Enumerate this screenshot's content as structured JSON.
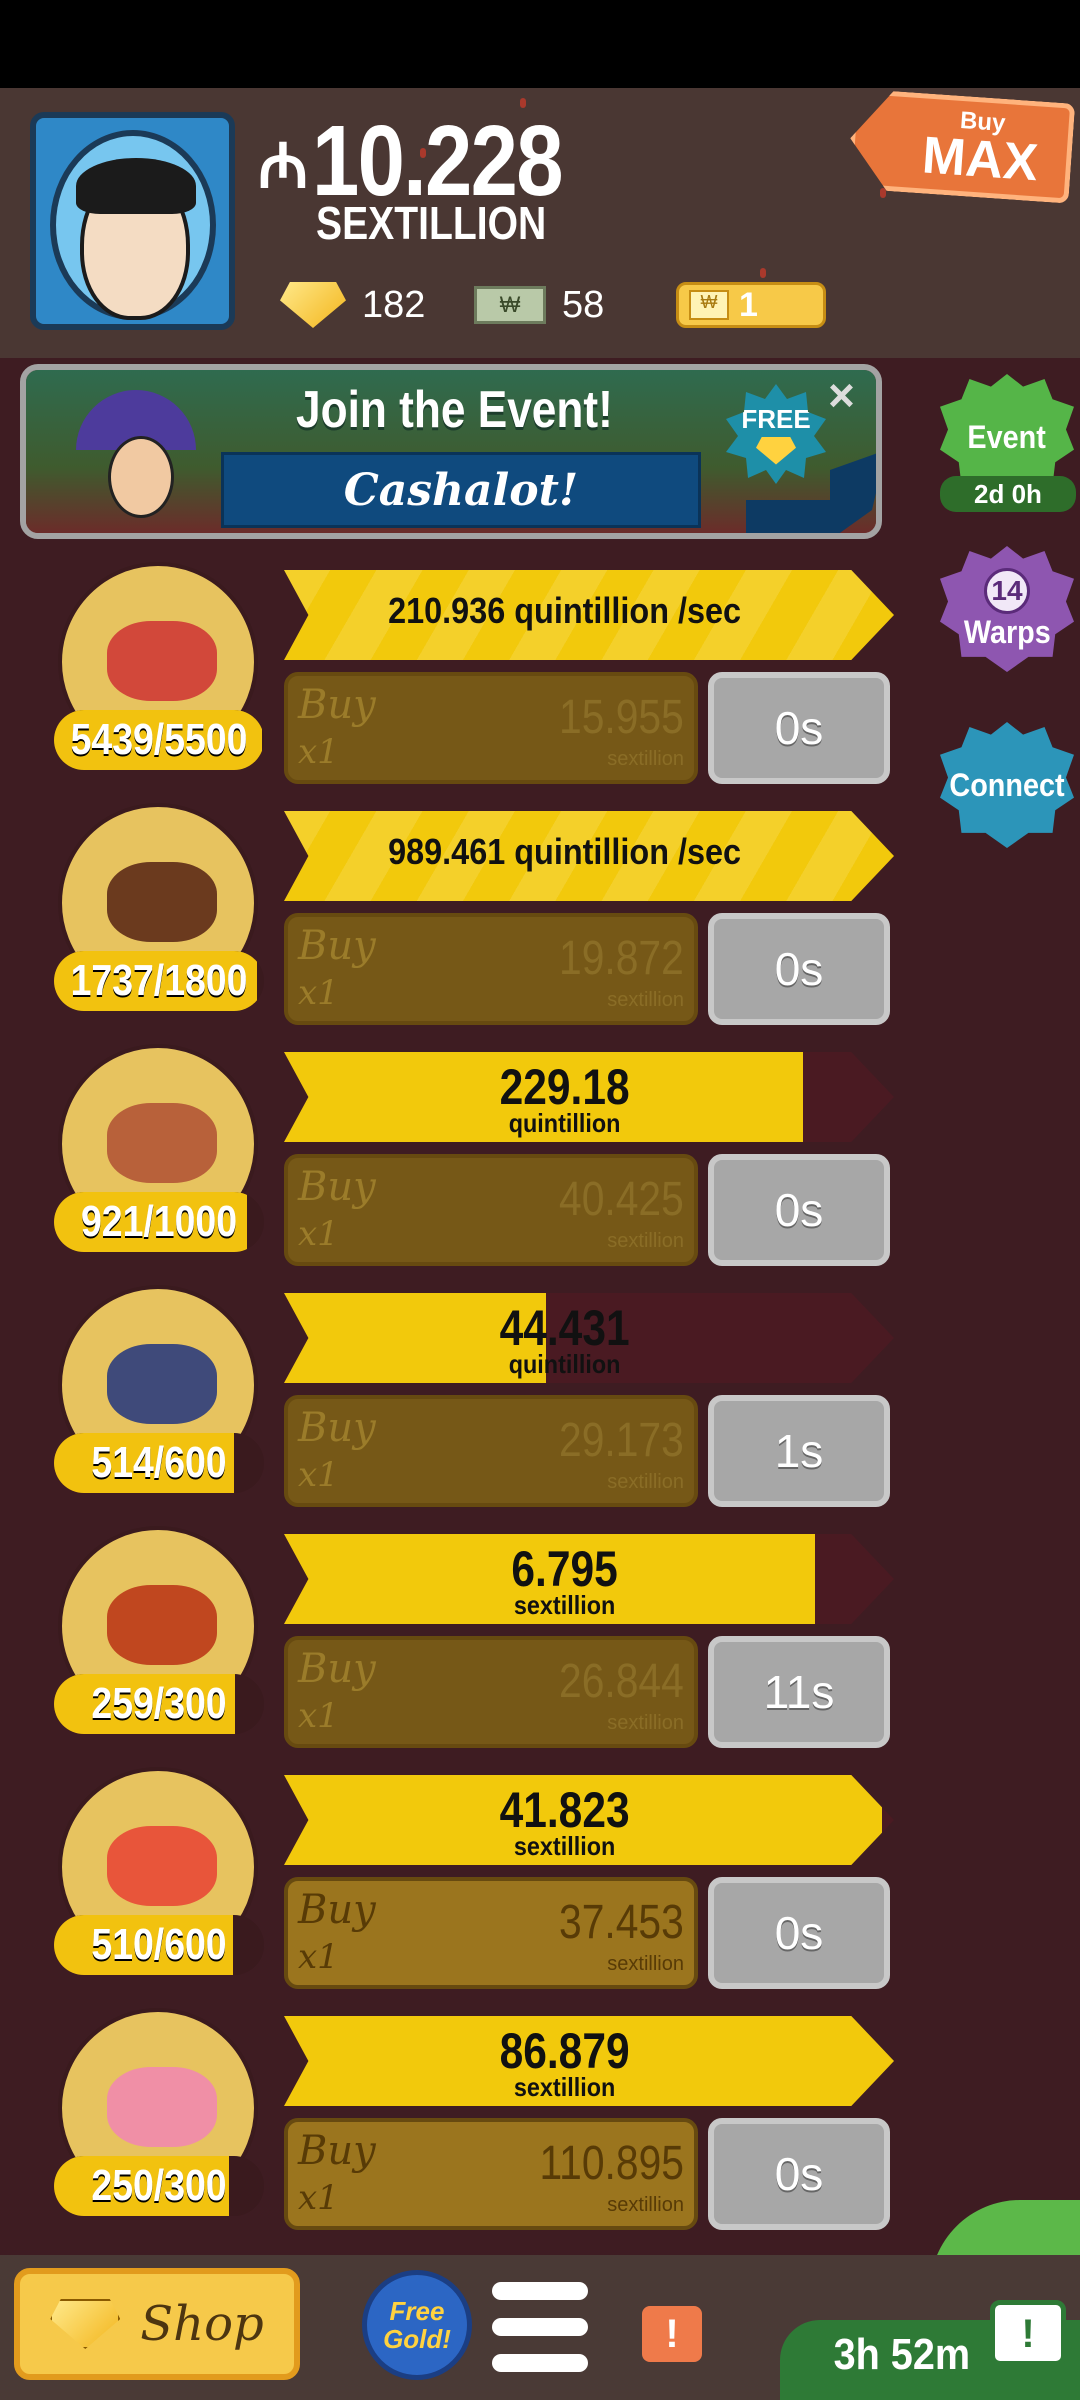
{
  "header": {
    "currency_symbol": "₼",
    "money_value": "10.228",
    "money_unit": "SEXTILLION",
    "gold": "182",
    "megabucks_icon_text": "₩",
    "megabucks": "58",
    "tickets": "1",
    "ticket_icon_text": "₩",
    "buy_max_small": "Buy",
    "buy_max_big": "MAX"
  },
  "event_banner": {
    "title": "Join the Event!",
    "event_name": "Cashalot!",
    "free_label": "FREE",
    "close": "×"
  },
  "side_buttons": {
    "event_label": "Event",
    "event_time": "2d 0h",
    "warps_count": "14",
    "warps_label": "Warps",
    "connect_label": "Connect"
  },
  "businesses": [
    {
      "icon": "red-dirt-icon",
      "progress_text": "5439/5500",
      "progress": 0.989,
      "revenue_mode": "rate",
      "revenue_text": "210.936 quintillion /sec",
      "revenue_fill": 1.0,
      "buy_line1": "Buy",
      "buy_line2": "x1",
      "cost": "15.955",
      "cost_unit": "sextillion",
      "timer": "0s",
      "affordable": false
    },
    {
      "icon": "chocolate-bar-icon",
      "progress_text": "1737/1800",
      "progress": 0.965,
      "revenue_mode": "rate",
      "revenue_text": "989.461 quintillion /sec",
      "revenue_fill": 1.0,
      "buy_line1": "Buy",
      "buy_line2": "x1",
      "cost": "19.872",
      "cost_unit": "sextillion",
      "timer": "0s",
      "affordable": false
    },
    {
      "icon": "bearded-man-icon",
      "progress_text": "921/1000",
      "progress": 0.921,
      "revenue_mode": "value",
      "revenue_value": "229.18",
      "revenue_unit": "quintillion",
      "revenue_fill": 0.85,
      "buy_line1": "Buy",
      "buy_line2": "x1",
      "cost": "40.425",
      "cost_unit": "sextillion",
      "timer": "0s",
      "affordable": false
    },
    {
      "icon": "spotted-bug-icon",
      "progress_text": "514/600",
      "progress": 0.857,
      "revenue_mode": "value",
      "revenue_value": "44.431",
      "revenue_unit": "quintillion",
      "revenue_fill": 0.43,
      "buy_line1": "Buy",
      "buy_line2": "x1",
      "cost": "29.173",
      "cost_unit": "sextillion",
      "timer": "1s",
      "affordable": false
    },
    {
      "icon": "dollar-coin-icon",
      "progress_text": "259/300",
      "progress": 0.863,
      "revenue_mode": "value",
      "revenue_value": "6.795",
      "revenue_unit": "sextillion",
      "revenue_fill": 0.87,
      "buy_line1": "Buy",
      "buy_line2": "x1",
      "cost": "26.844",
      "cost_unit": "sextillion",
      "timer": "11s",
      "affordable": false
    },
    {
      "icon": "space-clam-icon",
      "progress_text": "510/600",
      "progress": 0.85,
      "revenue_mode": "value",
      "revenue_value": "41.823",
      "revenue_unit": "sextillion",
      "revenue_fill": 0.98,
      "buy_line1": "Buy",
      "buy_line2": "x1",
      "cost": "37.453",
      "cost_unit": "sextillion",
      "timer": "0s",
      "affordable": true
    },
    {
      "icon": "brain-sunglasses-icon",
      "progress_text": "250/300",
      "progress": 0.833,
      "revenue_mode": "value",
      "revenue_value": "86.879",
      "revenue_unit": "sextillion",
      "revenue_fill": 1.0,
      "buy_line1": "Buy",
      "buy_line2": "x1",
      "cost": "110.895",
      "cost_unit": "sextillion",
      "timer": "0s",
      "affordable": true
    }
  ],
  "bottom": {
    "shop_label": "Shop",
    "free_gold_label": "Free Gold!",
    "alert_label": "!",
    "tv_time": "3h 52m",
    "tv_icon": "!"
  },
  "colors": {
    "accent_yellow": "#f2c90c",
    "background": "#3e1c22",
    "header": "#4a3733"
  }
}
